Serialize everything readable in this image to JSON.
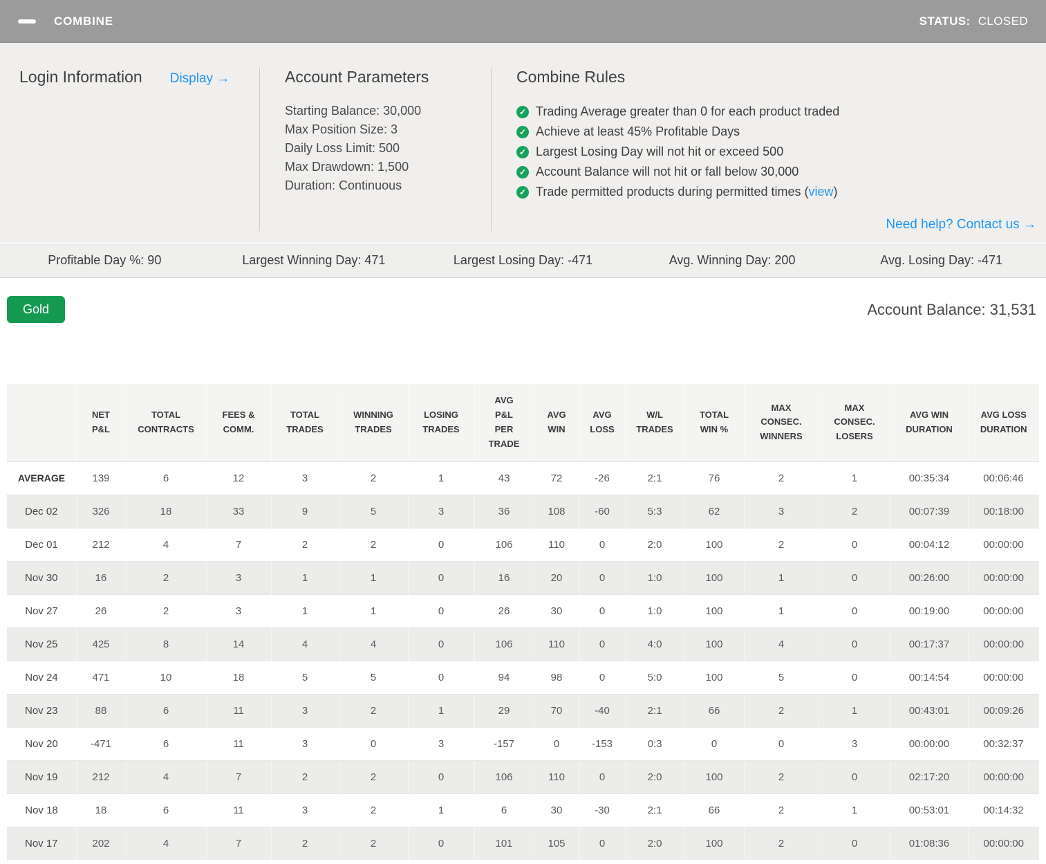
{
  "colors": {
    "title_bar_bg": "#9b9b9b",
    "panel_bg": "#f0efee",
    "link_blue": "#2196f3",
    "check_green": "#17a15b",
    "button_green": "#159a52",
    "stripe_gray": "#ececeb"
  },
  "title_bar": {
    "title": "COMBINE",
    "status_label": "STATUS:",
    "status_value": "CLOSED"
  },
  "login_info": {
    "heading": "Login Information",
    "display_link": "Display →"
  },
  "account_parameters": {
    "heading": "Account Parameters",
    "items": [
      "Starting Balance: 30,000",
      "Max Position Size: 3",
      "Daily Loss Limit: 500",
      "Max Drawdown: 1,500",
      "Duration: Continuous"
    ]
  },
  "combine_rules": {
    "heading": "Combine Rules",
    "check_glyph": "✓",
    "rules": [
      {
        "text": "Trading Average greater than 0 for each product traded"
      },
      {
        "text": "Achieve at least 45% Profitable Days"
      },
      {
        "text": "Largest Losing Day will not hit or exceed 500"
      },
      {
        "text": "Account Balance will not hit or fall below 30,000"
      },
      {
        "text": "Trade permitted products during permitted times (",
        "link": "view",
        "suffix": ")"
      }
    ]
  },
  "help_link": "Need help? Contact us →",
  "stats_bar": [
    "Profitable Day %: 90",
    "Largest Winning Day: 471",
    "Largest Losing Day: -471",
    "Avg. Winning Day: 200",
    "Avg. Losing Day: -471"
  ],
  "product_button": "Gold",
  "account_balance": "Account Balance: 31,531",
  "table": {
    "columns": [
      [
        "NET",
        "P&L"
      ],
      [
        "TOTAL",
        "CONTRACTS"
      ],
      [
        "FEES &",
        "COMM."
      ],
      [
        "TOTAL",
        "TRADES"
      ],
      [
        "WINNING",
        "TRADES"
      ],
      [
        "LOSING",
        "TRADES"
      ],
      [
        "AVG",
        "P&L",
        "PER",
        "TRADE"
      ],
      [
        "AVG",
        "WIN"
      ],
      [
        "AVG",
        "LOSS"
      ],
      [
        "W/L",
        "TRADES"
      ],
      [
        "TOTAL",
        "WIN %"
      ],
      [
        "MAX",
        "CONSEC.",
        "WINNERS"
      ],
      [
        "MAX",
        "CONSEC.",
        "LOSERS"
      ],
      [
        "AVG WIN",
        "DURATION"
      ],
      [
        "AVG LOSS",
        "DURATION"
      ]
    ],
    "rows": [
      {
        "label": "AVERAGE",
        "bold": true,
        "values": [
          "139",
          "6",
          "12",
          "3",
          "2",
          "1",
          "43",
          "72",
          "-26",
          "2:1",
          "76",
          "2",
          "1",
          "00:35:34",
          "00:06:46"
        ]
      },
      {
        "label": "Dec 02",
        "bold": false,
        "values": [
          "326",
          "18",
          "33",
          "9",
          "5",
          "3",
          "36",
          "108",
          "-60",
          "5:3",
          "62",
          "3",
          "2",
          "00:07:39",
          "00:18:00"
        ]
      },
      {
        "label": "Dec 01",
        "bold": false,
        "values": [
          "212",
          "4",
          "7",
          "2",
          "2",
          "0",
          "106",
          "110",
          "0",
          "2:0",
          "100",
          "2",
          "0",
          "00:04:12",
          "00:00:00"
        ]
      },
      {
        "label": "Nov 30",
        "bold": false,
        "values": [
          "16",
          "2",
          "3",
          "1",
          "1",
          "0",
          "16",
          "20",
          "0",
          "1:0",
          "100",
          "1",
          "0",
          "00:26:00",
          "00:00:00"
        ]
      },
      {
        "label": "Nov 27",
        "bold": false,
        "values": [
          "26",
          "2",
          "3",
          "1",
          "1",
          "0",
          "26",
          "30",
          "0",
          "1:0",
          "100",
          "1",
          "0",
          "00:19:00",
          "00:00:00"
        ]
      },
      {
        "label": "Nov 25",
        "bold": false,
        "values": [
          "425",
          "8",
          "14",
          "4",
          "4",
          "0",
          "106",
          "110",
          "0",
          "4:0",
          "100",
          "4",
          "0",
          "00:17:37",
          "00:00:00"
        ]
      },
      {
        "label": "Nov 24",
        "bold": false,
        "values": [
          "471",
          "10",
          "18",
          "5",
          "5",
          "0",
          "94",
          "98",
          "0",
          "5:0",
          "100",
          "5",
          "0",
          "00:14:54",
          "00:00:00"
        ]
      },
      {
        "label": "Nov 23",
        "bold": false,
        "values": [
          "88",
          "6",
          "11",
          "3",
          "2",
          "1",
          "29",
          "70",
          "-40",
          "2:1",
          "66",
          "2",
          "1",
          "00:43:01",
          "00:09:26"
        ]
      },
      {
        "label": "Nov 20",
        "bold": false,
        "values": [
          "-471",
          "6",
          "11",
          "3",
          "0",
          "3",
          "-157",
          "0",
          "-153",
          "0:3",
          "0",
          "0",
          "3",
          "00:00:00",
          "00:32:37"
        ]
      },
      {
        "label": "Nov 19",
        "bold": false,
        "values": [
          "212",
          "4",
          "7",
          "2",
          "2",
          "0",
          "106",
          "110",
          "0",
          "2:0",
          "100",
          "2",
          "0",
          "02:17:20",
          "00:00:00"
        ]
      },
      {
        "label": "Nov 18",
        "bold": false,
        "values": [
          "18",
          "6",
          "11",
          "3",
          "2",
          "1",
          "6",
          "30",
          "-30",
          "2:1",
          "66",
          "2",
          "1",
          "00:53:01",
          "00:14:32"
        ]
      },
      {
        "label": "Nov 17",
        "bold": false,
        "values": [
          "202",
          "4",
          "7",
          "2",
          "2",
          "0",
          "101",
          "105",
          "0",
          "2:0",
          "100",
          "2",
          "0",
          "01:08:36",
          "00:00:00"
        ]
      }
    ]
  }
}
